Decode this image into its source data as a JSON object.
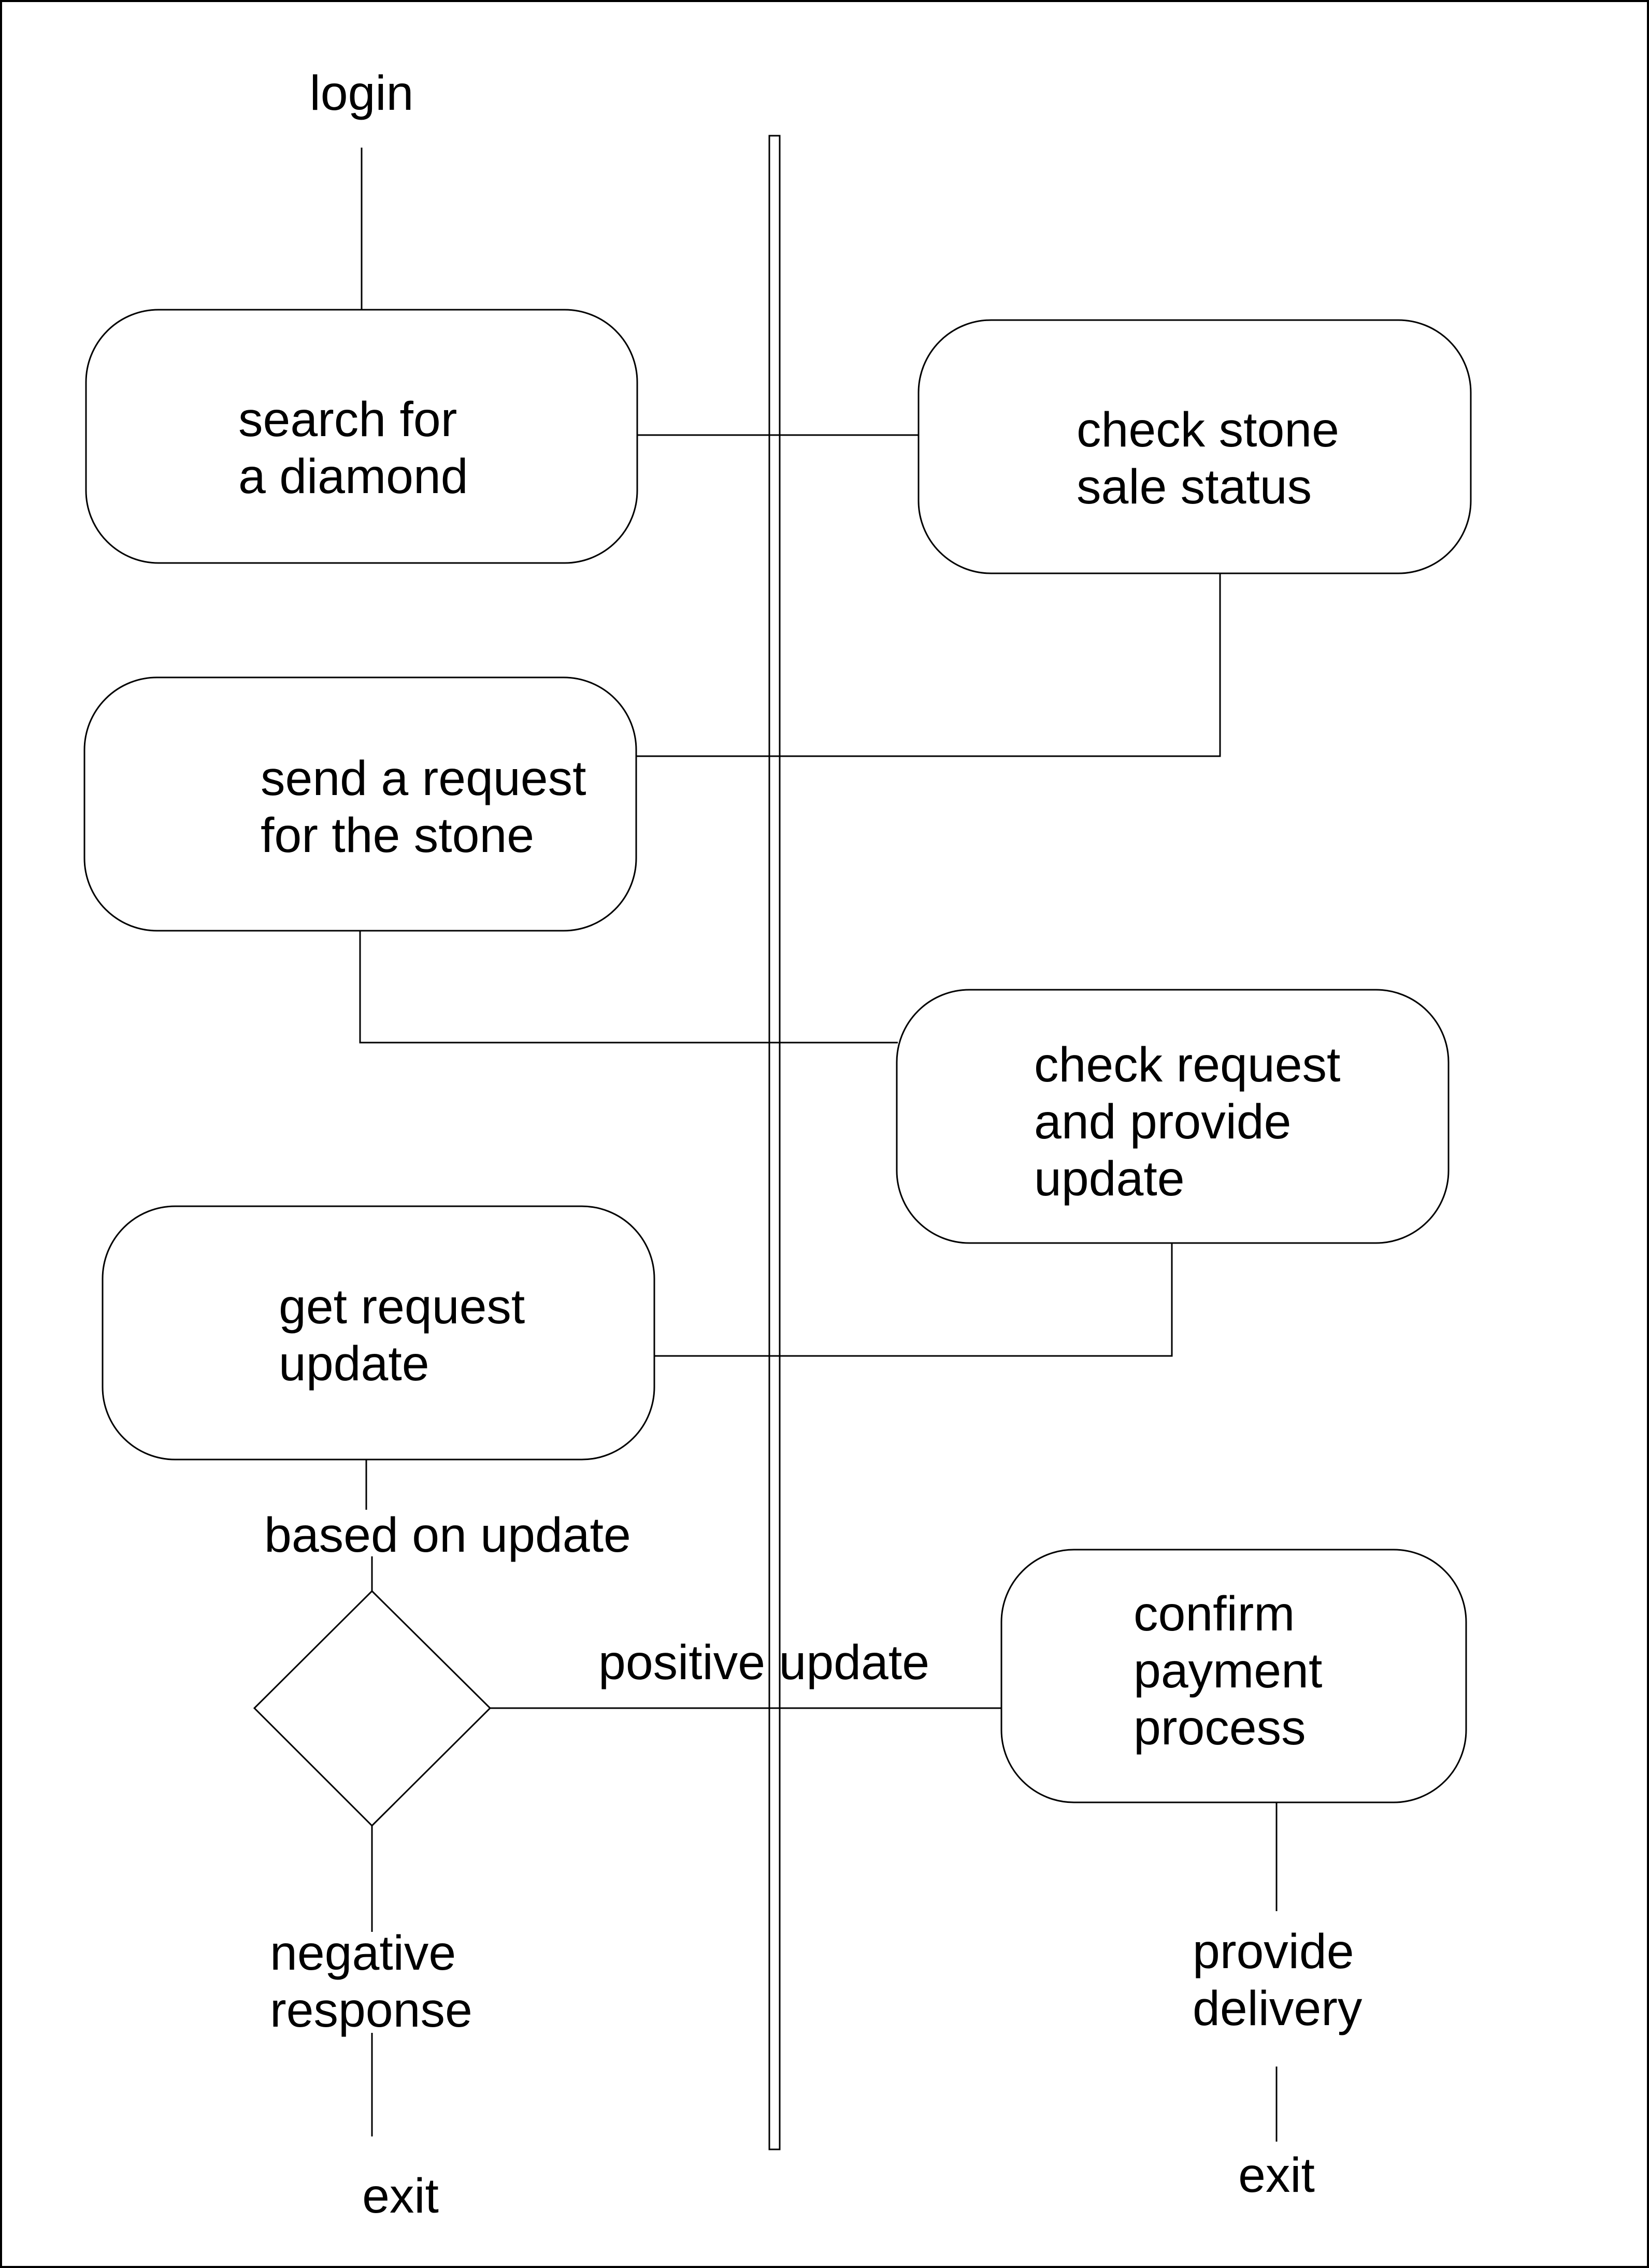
{
  "diagram": {
    "type": "activity-diagram",
    "colors": {
      "stroke": "#000000",
      "background": "#ffffff",
      "text": "#000000"
    },
    "start_label": "login",
    "nodes": [
      {
        "id": "search",
        "lines": [
          "search for",
          "a diamond"
        ]
      },
      {
        "id": "check-status",
        "lines": [
          "check stone",
          "sale status"
        ]
      },
      {
        "id": "send-request",
        "lines": [
          "send a request",
          "for the stone"
        ]
      },
      {
        "id": "check-request",
        "lines": [
          "check request",
          "and provide",
          "update"
        ]
      },
      {
        "id": "get-update",
        "lines": [
          "get request",
          "update"
        ]
      },
      {
        "id": "confirm-payment",
        "lines": [
          "confirm",
          "payment",
          "process"
        ]
      }
    ],
    "decision_label": "based on update",
    "positive_label": "positive update",
    "negative_label": [
      "negative",
      "response"
    ],
    "delivery_label": [
      "provide",
      "delivery"
    ],
    "exit_left": "exit",
    "exit_right": "exit"
  }
}
